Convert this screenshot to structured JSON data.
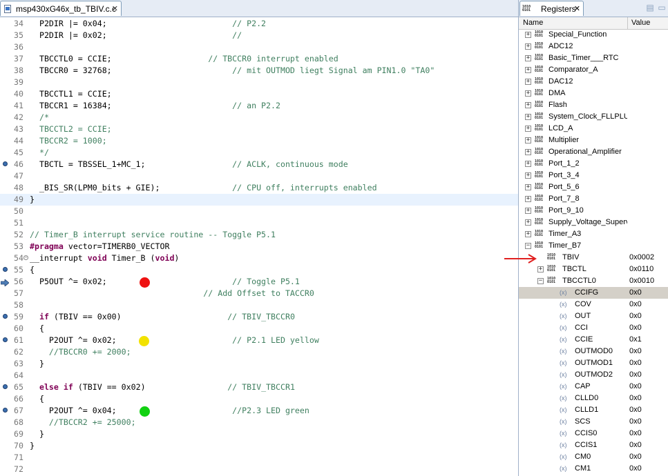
{
  "editor": {
    "tab_title": "msp430xG46x_tb_TBIV.c.c",
    "lines": [
      {
        "n": "34",
        "segs": [
          {
            "t": "  P2DIR |= 0x04;                          "
          },
          {
            "c": "cmt",
            "t": "// P2.2"
          }
        ]
      },
      {
        "n": "35",
        "segs": [
          {
            "t": "  P2DIR |= 0x02;                          "
          },
          {
            "c": "cmt",
            "t": "//"
          }
        ]
      },
      {
        "n": "36",
        "segs": []
      },
      {
        "n": "37",
        "segs": [
          {
            "t": "  TBCCTL0 = CCIE;                    "
          },
          {
            "c": "cmt",
            "t": "// TBCCR0 interrupt enabled"
          }
        ]
      },
      {
        "n": "38",
        "segs": [
          {
            "t": "  TBCCR0 = 32768;                         "
          },
          {
            "c": "cmt",
            "t": "// mit OUTMOD liegt Signal am PIN1.0 \"TA0\""
          }
        ]
      },
      {
        "n": "39",
        "segs": []
      },
      {
        "n": "40",
        "segs": [
          {
            "t": "  TBCCTL1 = CCIE;"
          }
        ]
      },
      {
        "n": "41",
        "segs": [
          {
            "t": "  TBCCR1 = 16384;                         "
          },
          {
            "c": "cmt",
            "t": "// an P2.2"
          }
        ]
      },
      {
        "n": "42",
        "segs": [
          {
            "c": "cmt",
            "t": "  /*"
          }
        ]
      },
      {
        "n": "43",
        "segs": [
          {
            "c": "cmt",
            "t": "  TBCCTL2 = CCIE;"
          }
        ]
      },
      {
        "n": "44",
        "segs": [
          {
            "c": "cmt",
            "t": "  TBCCR2 = 1000;"
          }
        ]
      },
      {
        "n": "45",
        "segs": [
          {
            "c": "cmt",
            "t": "  */"
          }
        ]
      },
      {
        "n": "46",
        "segs": [
          {
            "t": "  TBCTL = TBSSEL_1+MC_1;                  "
          },
          {
            "c": "cmt",
            "t": "// ACLK, continuous mode"
          }
        ]
      },
      {
        "n": "47",
        "segs": []
      },
      {
        "n": "48",
        "segs": [
          {
            "t": "  _BIS_SR(LPM0_bits + GIE);               "
          },
          {
            "c": "cmt",
            "t": "// CPU off, interrupts enabled"
          }
        ]
      },
      {
        "n": "49",
        "segs": [
          {
            "t": "}"
          }
        ]
      },
      {
        "n": "50",
        "segs": []
      },
      {
        "n": "51",
        "segs": []
      },
      {
        "n": "52",
        "segs": [
          {
            "c": "cmt",
            "t": "// Timer_B interrupt service routine -- Toggle P5.1"
          }
        ]
      },
      {
        "n": "53",
        "segs": [
          {
            "c": "kw",
            "t": "#pragma"
          },
          {
            "t": " vector=TIMERB0_VECTOR"
          }
        ]
      },
      {
        "n": "54",
        "segs": [
          {
            "t": "__interrupt "
          },
          {
            "c": "kw",
            "t": "void"
          },
          {
            "t": " Timer_B ("
          },
          {
            "c": "kw",
            "t": "void"
          },
          {
            "t": ")"
          }
        ]
      },
      {
        "n": "55",
        "segs": [
          {
            "t": "{"
          }
        ]
      },
      {
        "n": "56",
        "segs": [
          {
            "t": "  P5OUT ^= 0x02;                          "
          },
          {
            "c": "cmt",
            "t": "// Toggle P5.1"
          }
        ]
      },
      {
        "n": "57",
        "segs": [
          {
            "t": "                                    "
          },
          {
            "c": "cmt",
            "t": "// Add Offset to TACCR0"
          }
        ]
      },
      {
        "n": "58",
        "segs": []
      },
      {
        "n": "59",
        "segs": [
          {
            "t": "  "
          },
          {
            "c": "kw",
            "t": "if"
          },
          {
            "t": " (TBIV == 0x00)                      "
          },
          {
            "c": "cmt",
            "t": "// TBIV_TBCCR0"
          }
        ]
      },
      {
        "n": "60",
        "segs": [
          {
            "t": "  {"
          }
        ]
      },
      {
        "n": "61",
        "segs": [
          {
            "t": "    P2OUT ^= 0x02;                        "
          },
          {
            "c": "cmt",
            "t": "// P2.1 LED yellow"
          }
        ]
      },
      {
        "n": "62",
        "segs": [
          {
            "c": "cmt",
            "t": "    //TBCCR0 += 2000;"
          }
        ]
      },
      {
        "n": "63",
        "segs": [
          {
            "t": "  }"
          }
        ]
      },
      {
        "n": "64",
        "segs": []
      },
      {
        "n": "65",
        "segs": [
          {
            "t": "  "
          },
          {
            "c": "kw",
            "t": "else if"
          },
          {
            "t": " (TBIV == 0x02)                 "
          },
          {
            "c": "cmt",
            "t": "// TBIV_TBCCR1"
          }
        ]
      },
      {
        "n": "66",
        "segs": [
          {
            "t": "  {"
          }
        ]
      },
      {
        "n": "67",
        "segs": [
          {
            "t": "    P2OUT ^= 0x04;                        "
          },
          {
            "c": "cmt",
            "t": "//P2.3 LED green"
          }
        ]
      },
      {
        "n": "68",
        "segs": [
          {
            "c": "cmt",
            "t": "    //TBCCR2 += 25000;"
          }
        ]
      },
      {
        "n": "69",
        "segs": [
          {
            "t": "  }"
          }
        ]
      },
      {
        "n": "70",
        "segs": [
          {
            "t": "}"
          }
        ]
      },
      {
        "n": "71",
        "segs": []
      },
      {
        "n": "72",
        "segs": []
      }
    ]
  },
  "markers": {
    "bookmark_lines": [
      "46",
      "55",
      "59",
      "61",
      "65",
      "67"
    ],
    "pin_line": "56",
    "fold_line": "54",
    "current_line": "49",
    "colors": {
      "red": "#ee1111",
      "yellow": "#f2e200",
      "green": "#11d111",
      "arrow": "#e02020"
    }
  },
  "registers": {
    "tab_label": "Registers",
    "col_name": "Name",
    "col_value": "Value",
    "rows": [
      {
        "level": 0,
        "exp": "+",
        "icon": "group",
        "name": "Special_Function",
        "value": ""
      },
      {
        "level": 0,
        "exp": "+",
        "icon": "group",
        "name": "ADC12",
        "value": ""
      },
      {
        "level": 0,
        "exp": "+",
        "icon": "group",
        "name": "Basic_Timer___RTC",
        "value": ""
      },
      {
        "level": 0,
        "exp": "+",
        "icon": "group",
        "name": "Comparator_A",
        "value": ""
      },
      {
        "level": 0,
        "exp": "+",
        "icon": "group",
        "name": "DAC12",
        "value": ""
      },
      {
        "level": 0,
        "exp": "+",
        "icon": "group",
        "name": "DMA",
        "value": ""
      },
      {
        "level": 0,
        "exp": "+",
        "icon": "group",
        "name": "Flash",
        "value": ""
      },
      {
        "level": 0,
        "exp": "+",
        "icon": "group",
        "name": "System_Clock_FLLPLUS",
        "value": ""
      },
      {
        "level": 0,
        "exp": "+",
        "icon": "group",
        "name": "LCD_A",
        "value": ""
      },
      {
        "level": 0,
        "exp": "+",
        "icon": "group",
        "name": "Multiplier",
        "value": ""
      },
      {
        "level": 0,
        "exp": "+",
        "icon": "group",
        "name": "Operational_Amplifier",
        "value": ""
      },
      {
        "level": 0,
        "exp": "+",
        "icon": "group",
        "name": "Port_1_2",
        "value": ""
      },
      {
        "level": 0,
        "exp": "+",
        "icon": "group",
        "name": "Port_3_4",
        "value": ""
      },
      {
        "level": 0,
        "exp": "+",
        "icon": "group",
        "name": "Port_5_6",
        "value": ""
      },
      {
        "level": 0,
        "exp": "+",
        "icon": "group",
        "name": "Port_7_8",
        "value": ""
      },
      {
        "level": 0,
        "exp": "+",
        "icon": "group",
        "name": "Port_9_10",
        "value": ""
      },
      {
        "level": 0,
        "exp": "+",
        "icon": "group",
        "name": "Supply_Voltage_Supervisor",
        "value": ""
      },
      {
        "level": 0,
        "exp": "+",
        "icon": "group",
        "name": "Timer_A3",
        "value": ""
      },
      {
        "level": 0,
        "exp": "-",
        "icon": "group",
        "name": "Timer_B7",
        "value": ""
      },
      {
        "level": 1,
        "exp": "",
        "icon": "reg",
        "name": "TBIV",
        "value": "0x0002"
      },
      {
        "level": 1,
        "exp": "+",
        "icon": "reg",
        "name": "TBCTL",
        "value": "0x0110"
      },
      {
        "level": 1,
        "exp": "-",
        "icon": "reg",
        "name": "TBCCTL0",
        "value": "0x0010"
      },
      {
        "level": 2,
        "exp": "",
        "icon": "field",
        "name": "CCIFG",
        "value": "0x0",
        "selected": true
      },
      {
        "level": 2,
        "exp": "",
        "icon": "field",
        "name": "COV",
        "value": "0x0"
      },
      {
        "level": 2,
        "exp": "",
        "icon": "field",
        "name": "OUT",
        "value": "0x0"
      },
      {
        "level": 2,
        "exp": "",
        "icon": "field",
        "name": "CCI",
        "value": "0x0"
      },
      {
        "level": 2,
        "exp": "",
        "icon": "field",
        "name": "CCIE",
        "value": "0x1"
      },
      {
        "level": 2,
        "exp": "",
        "icon": "field",
        "name": "OUTMOD0",
        "value": "0x0"
      },
      {
        "level": 2,
        "exp": "",
        "icon": "field",
        "name": "OUTMOD1",
        "value": "0x0"
      },
      {
        "level": 2,
        "exp": "",
        "icon": "field",
        "name": "OUTMOD2",
        "value": "0x0"
      },
      {
        "level": 2,
        "exp": "",
        "icon": "field",
        "name": "CAP",
        "value": "0x0"
      },
      {
        "level": 2,
        "exp": "",
        "icon": "field",
        "name": "CLLD0",
        "value": "0x0"
      },
      {
        "level": 2,
        "exp": "",
        "icon": "field",
        "name": "CLLD1",
        "value": "0x0"
      },
      {
        "level": 2,
        "exp": "",
        "icon": "field",
        "name": "SCS",
        "value": "0x0"
      },
      {
        "level": 2,
        "exp": "",
        "icon": "field",
        "name": "CCIS0",
        "value": "0x0"
      },
      {
        "level": 2,
        "exp": "",
        "icon": "field",
        "name": "CCIS1",
        "value": "0x0"
      },
      {
        "level": 2,
        "exp": "",
        "icon": "field",
        "name": "CM0",
        "value": "0x0"
      },
      {
        "level": 2,
        "exp": "",
        "icon": "field",
        "name": "CM1",
        "value": "0x0"
      }
    ]
  }
}
